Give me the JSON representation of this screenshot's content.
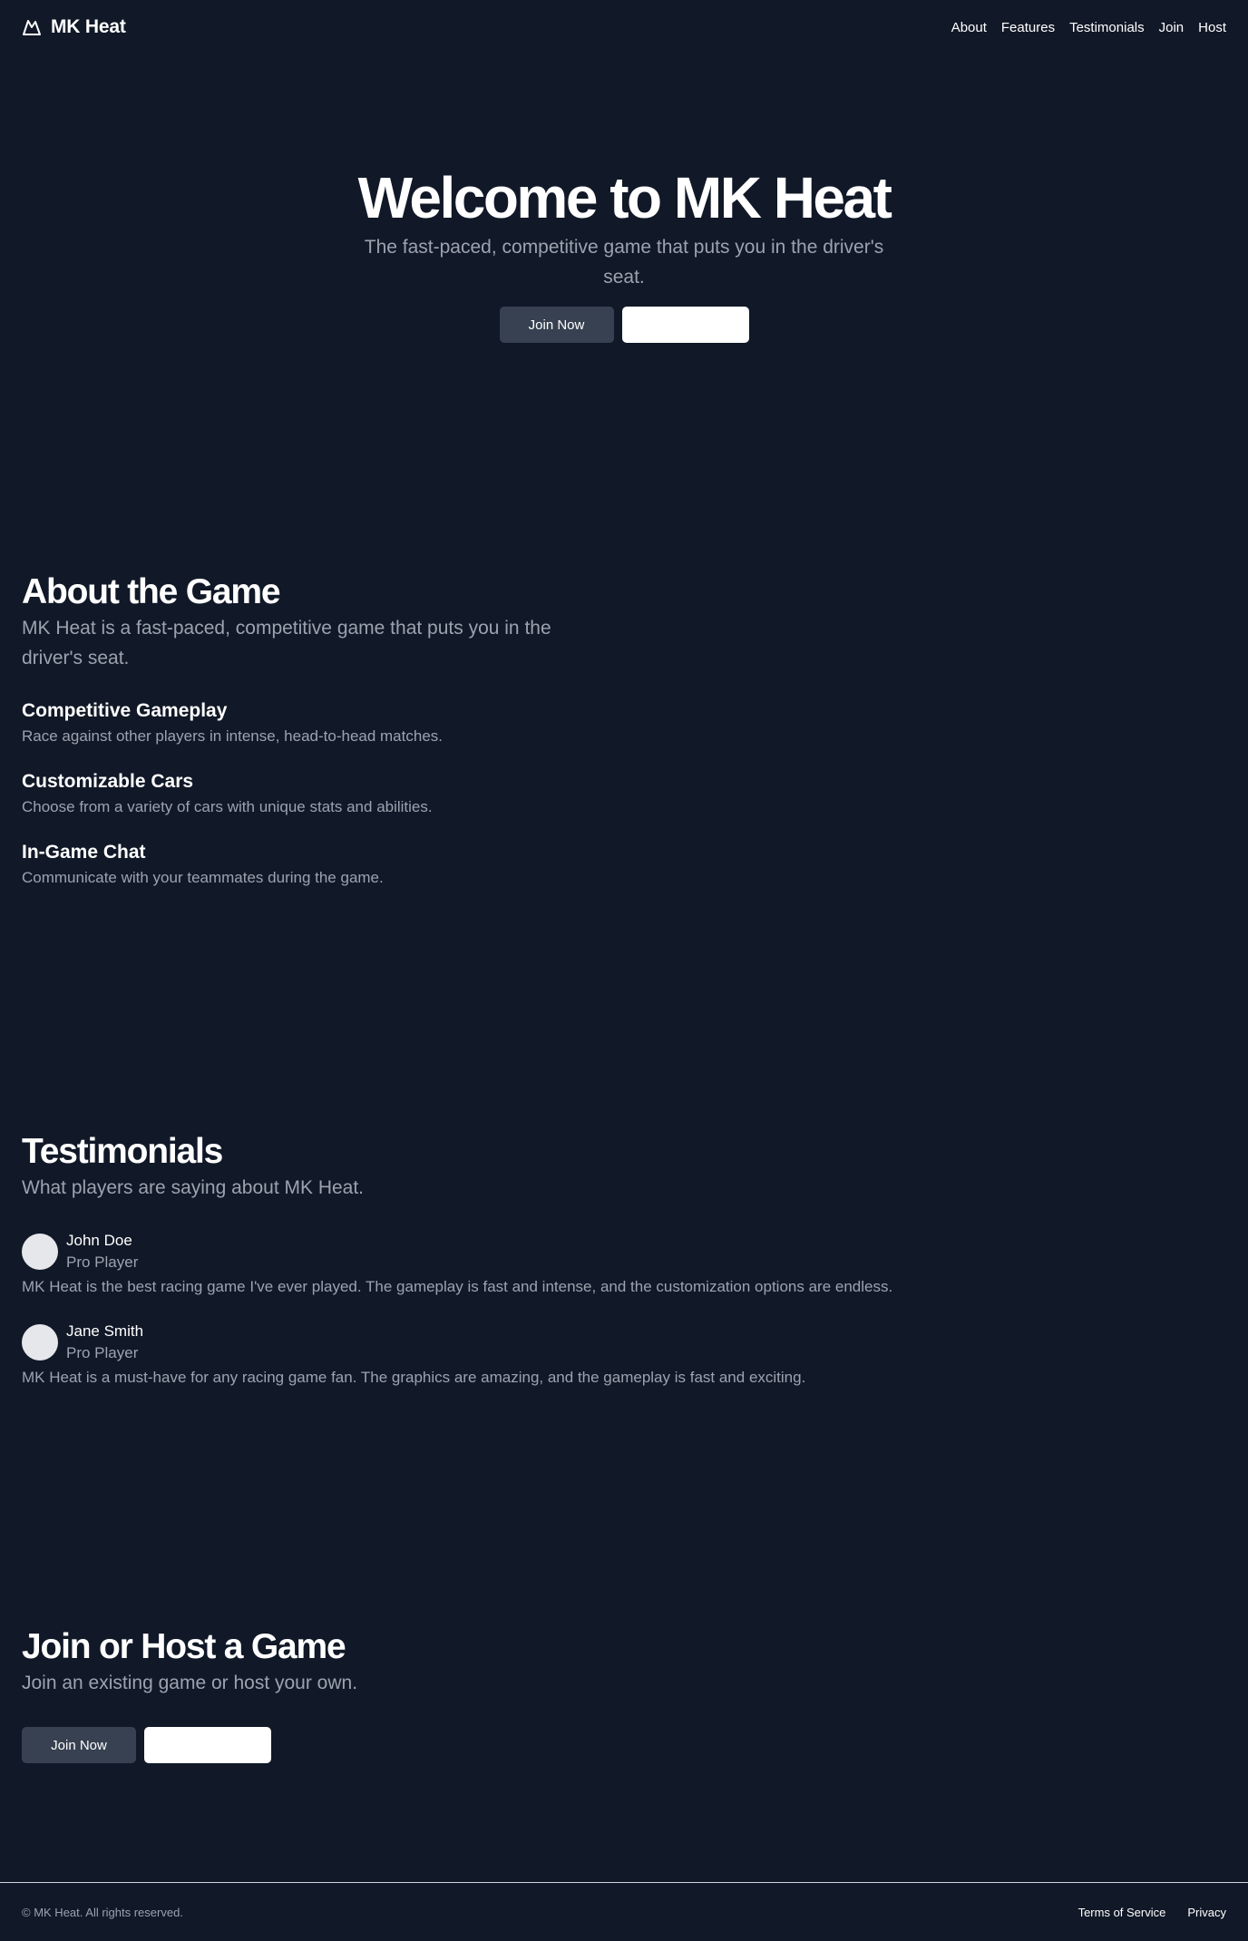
{
  "header": {
    "brand": "MK Heat",
    "logo_icon": "mountain-icon",
    "nav": [
      "About",
      "Features",
      "Testimonials",
      "Join",
      "Host"
    ]
  },
  "hero": {
    "title": "Welcome to MK Heat",
    "subtitle": "The fast-paced, competitive game that puts you in the driver's seat.",
    "primary_button": "Join Now",
    "secondary_button": ""
  },
  "about": {
    "title": "About the Game",
    "lead": "MK Heat is a fast-paced, competitive game that puts you in the driver's seat.",
    "features": [
      {
        "title": "Competitive Gameplay",
        "text": "Race against other players in intense, head-to-head matches."
      },
      {
        "title": "Customizable Cars",
        "text": "Choose from a variety of cars with unique stats and abilities."
      },
      {
        "title": "In-Game Chat",
        "text": "Communicate with your teammates during the game."
      }
    ]
  },
  "testimonials": {
    "title": "Testimonials",
    "lead": "What players are saying about MK Heat.",
    "items": [
      {
        "name": "John Doe",
        "role": "Pro Player",
        "quote": "MK Heat is the best racing game I've ever played. The gameplay is fast and intense, and the customization options are endless."
      },
      {
        "name": "Jane Smith",
        "role": "Pro Player",
        "quote": "MK Heat is a must-have for any racing game fan. The graphics are amazing, and the gameplay is fast and exciting."
      }
    ]
  },
  "join": {
    "title": "Join or Host a Game",
    "lead": "Join an existing game or host your own.",
    "primary_button": "Join Now",
    "secondary_button": ""
  },
  "footer": {
    "copyright": "© MK Heat. All rights reserved.",
    "links": [
      "Terms of Service",
      "Privacy"
    ]
  },
  "colors": {
    "background": "#111827",
    "muted_text": "#9ca3af",
    "dark_button": "#374151",
    "light_button": "#ffffff"
  }
}
